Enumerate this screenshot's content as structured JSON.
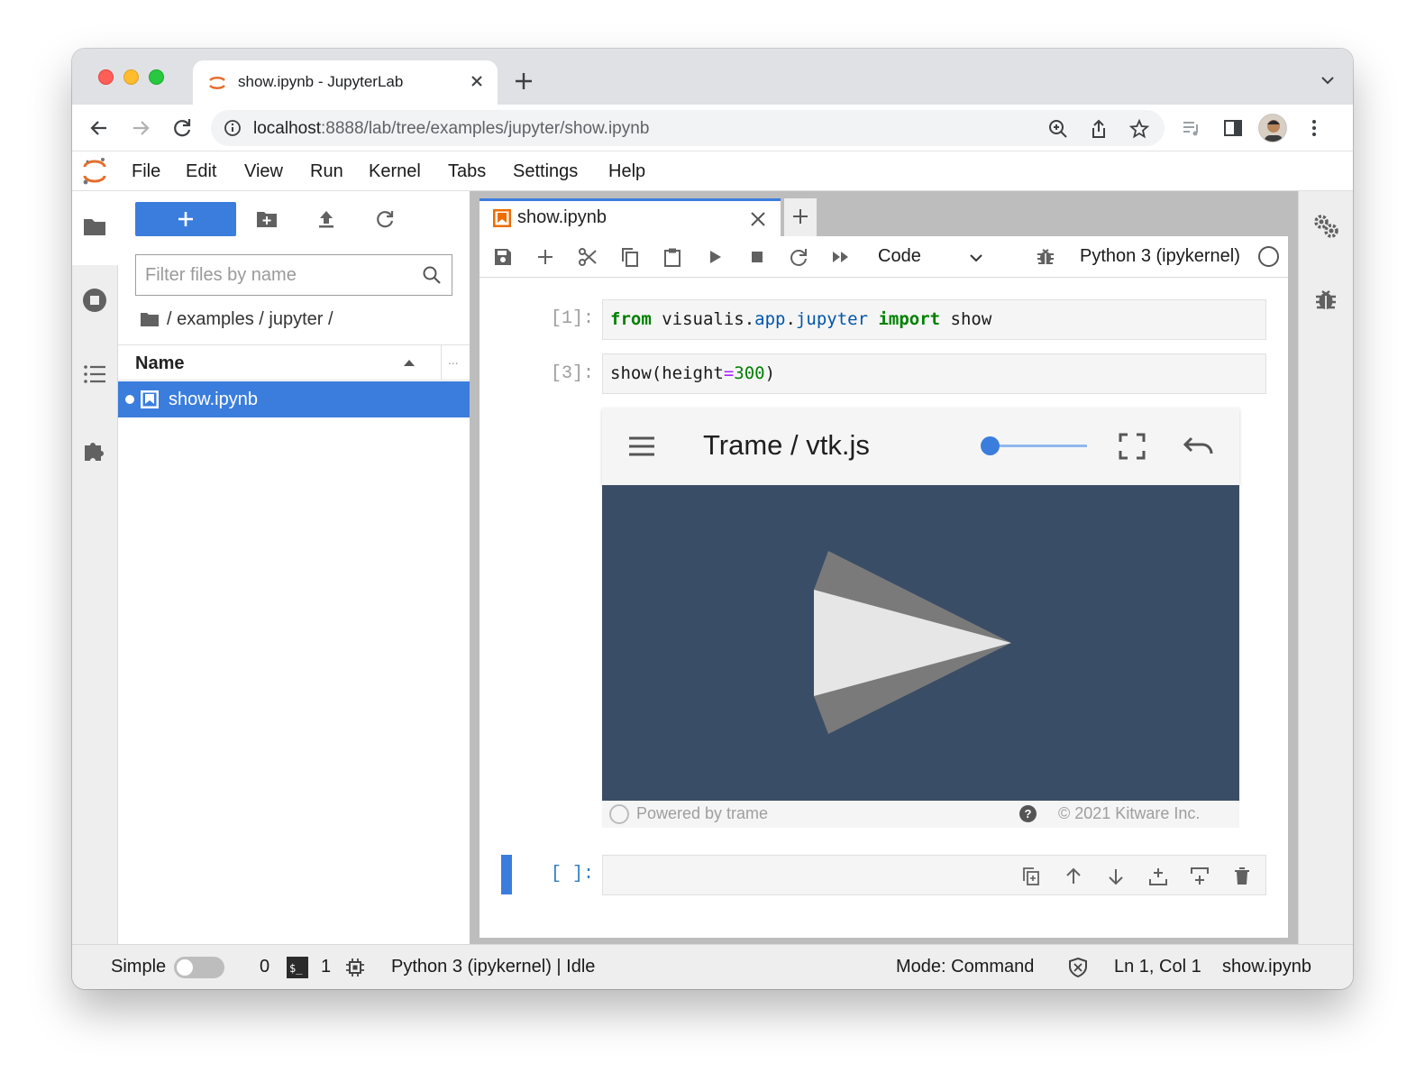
{
  "browser": {
    "tab_title": "show.ipynb - JupyterLab",
    "url_host": "localhost",
    "url_rest": ":8888/lab/tree/examples/jupyter/show.ipynb"
  },
  "menubar": {
    "items": [
      "File",
      "Edit",
      "View",
      "Run",
      "Kernel",
      "Tabs",
      "Settings",
      "Help"
    ]
  },
  "filebrowser": {
    "filter_placeholder": "Filter files by name",
    "breadcrumb": "/ examples / jupyter /",
    "column_name": "Name",
    "column_more": "...",
    "files": [
      {
        "name": "show.ipynb",
        "selected": true,
        "running": true
      }
    ]
  },
  "notebook": {
    "tab_title": "show.ipynb",
    "cell_type": "Code",
    "kernel": "Python 3 (ipykernel)",
    "cells": [
      {
        "prompt": "[1]:",
        "code_parts": [
          "from",
          " visualis.",
          "app",
          ".",
          "jupyter",
          " ",
          "import",
          " show"
        ]
      },
      {
        "prompt": "[3]:",
        "code_parts": [
          "show(height",
          "=",
          "300",
          ")"
        ]
      },
      {
        "prompt": "[ ]:"
      }
    ]
  },
  "trame": {
    "title": "Trame / vtk.js",
    "slider_value": 0.0,
    "footer_left": "Powered by trame",
    "footer_help": "?",
    "footer_right": "© 2021 Kitware Inc."
  },
  "statusbar": {
    "mode_label": "Simple",
    "simple_mode_on": false,
    "terminals_count": "0",
    "terminal_glyph": "$_",
    "kernels_count": "1",
    "kernel_status": "Python 3 (ipykernel) | Idle",
    "mode": "Mode: Command",
    "cursor": "Ln 1, Col 1",
    "filename": "show.ipynb"
  },
  "colors": {
    "accent": "#3b7ddd",
    "vtk_background": "#3a4d66",
    "keyword": "#008000",
    "module": "#0055aa",
    "operator": "#aa22ff"
  }
}
